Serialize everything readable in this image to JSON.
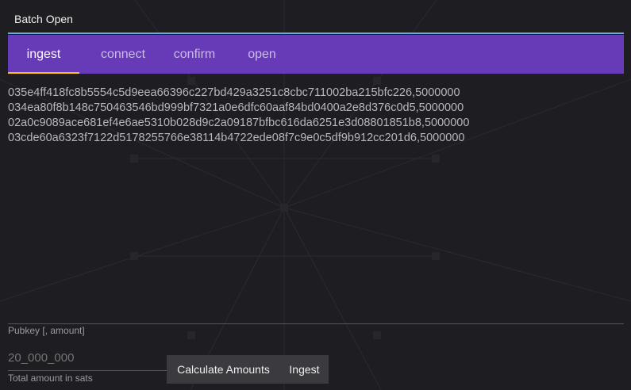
{
  "window": {
    "title": "Batch Open"
  },
  "tabs": [
    {
      "label": "ingest",
      "active": true
    },
    {
      "label": "connect",
      "active": false
    },
    {
      "label": "confirm",
      "active": false
    },
    {
      "label": "open",
      "active": false
    }
  ],
  "ingest": {
    "textarea_value": "035e4ff418fc8b5554c5d9eea66396c227bd429a3251c8cbc711002ba215bfc226,5000000\n034ea80f8b148c750463546bd999bf7321a0e6dfc60aaf84bd0400a2e8d376c0d5,5000000\n02a0c9089ace681ef4e6ae5310b028d9c2a09187bfbc616da6251e3d08801851b8,5000000\n03cde60a6323f7122d5178255766e38114b4722ede08f7c9e0c5df9b912cc201d6,5000000",
    "textarea_label": "Pubkey [, amount]",
    "amount_placeholder": "20_000_000",
    "amount_label": "Total amount in sats",
    "calculate_label": "Calculate Amounts",
    "ingest_label": "Ingest"
  },
  "colors": {
    "tab_bar": "#673ab7",
    "tab_indicator": "#ffc107",
    "title_rule": "#5fb3cf",
    "background": "#1d1d22"
  }
}
